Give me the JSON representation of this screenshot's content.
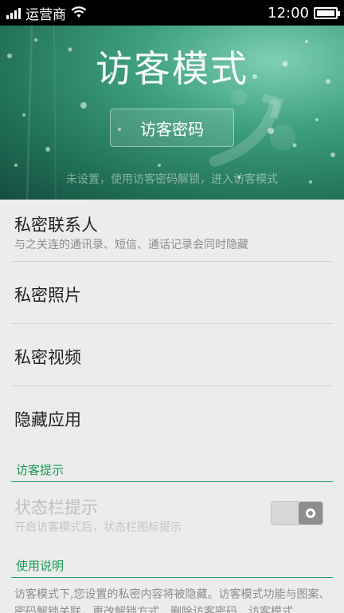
{
  "status_bar": {
    "carrier": "运营商",
    "time": "12:00",
    "battery_level": 1.0
  },
  "hero": {
    "title": "访客模式",
    "password_button": "访客密码",
    "subtitle": "未设置，使用访客密码解锁，进入访客模式"
  },
  "list": {
    "items": [
      {
        "title": "私密联系人",
        "subtitle": "与之关连的通讯录、短信、通话记录会同时隐藏"
      },
      {
        "title": "私密照片"
      },
      {
        "title": "私密视频"
      },
      {
        "title": "隐藏应用"
      }
    ]
  },
  "sections": {
    "hint_header": "访客提示",
    "usage_header": "使用说明"
  },
  "status_hint": {
    "title": "状态栏提示",
    "subtitle": "开启访客模式后，状态栏图标提示",
    "enabled": false
  },
  "usage": {
    "text": "访客模式下,您设置的私密内容将被隐藏。访客模式功能与图案、密码解锁关联，更改解锁方式、删除访客密码，访客模式"
  },
  "colors": {
    "accent_green": "#1a9a57",
    "hero_green": "#2e8a6c"
  }
}
